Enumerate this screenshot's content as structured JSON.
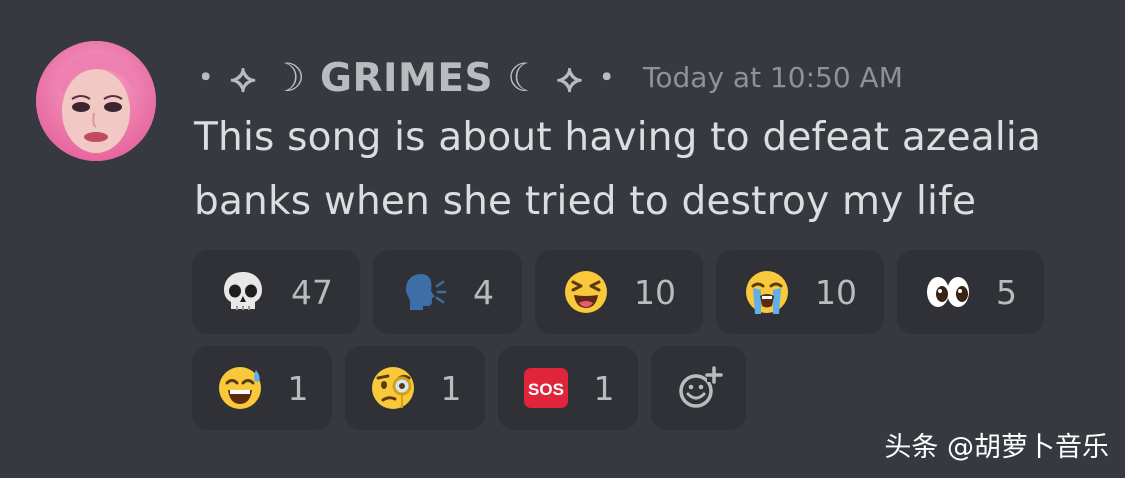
{
  "message": {
    "author": {
      "display_name": "･ ⟡ ☽ GRIMES ☾ ⟡ ･",
      "name": "GRIMES",
      "avatar_icon": "avatar-photo"
    },
    "timestamp": "Today at 10:50 AM",
    "content": "This song is about having to defeat azealia banks when she tried to destroy my life"
  },
  "reactions": [
    {
      "emoji": "skull",
      "count": "47"
    },
    {
      "emoji": "speaking-head",
      "count": "4"
    },
    {
      "emoji": "laughing-face",
      "count": "10"
    },
    {
      "emoji": "loudly-crying-face",
      "count": "10"
    },
    {
      "emoji": "eyes",
      "count": "5"
    },
    {
      "emoji": "sweat-smile",
      "count": "1"
    },
    {
      "emoji": "face-with-monocle",
      "count": "1"
    },
    {
      "emoji": "sos-button",
      "count": "1"
    }
  ],
  "add_reaction_icon": "add-reaction-icon",
  "watermark": "头条 @胡萝卜音乐",
  "colors": {
    "background": "#36393f",
    "reaction_background": "#2f3136",
    "username": "#b9bbbe",
    "timestamp": "#8e9297",
    "text": "#dcddde"
  }
}
